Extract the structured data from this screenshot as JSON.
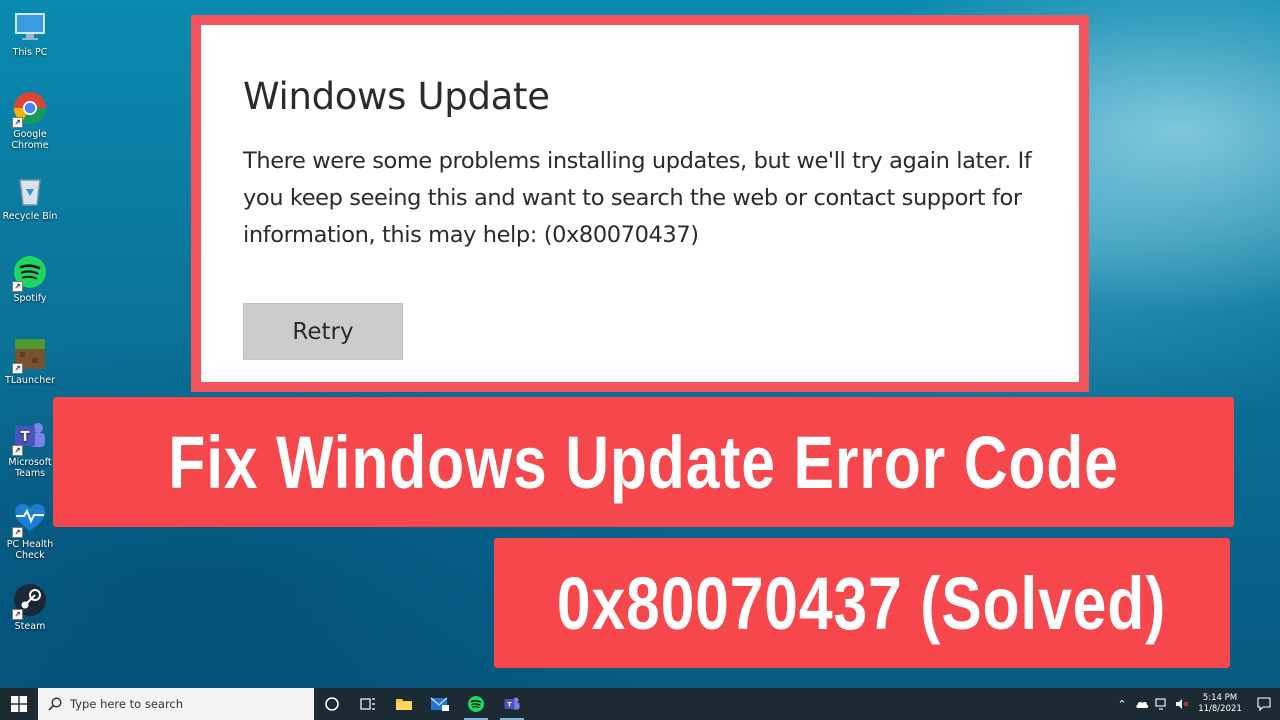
{
  "desktop_icons": [
    {
      "label": "This PC",
      "icon": "this-pc-icon"
    },
    {
      "label": "Google Chrome",
      "icon": "chrome-icon"
    },
    {
      "label": "Recycle Bin",
      "icon": "recycle-bin-icon"
    },
    {
      "label": "Spotify",
      "icon": "spotify-icon"
    },
    {
      "label": "TLauncher",
      "icon": "tlauncher-icon"
    },
    {
      "label": "Microsoft Teams",
      "icon": "teams-icon"
    },
    {
      "label": "PC Health Check",
      "icon": "pc-health-check-icon"
    },
    {
      "label": "Steam",
      "icon": "steam-icon"
    }
  ],
  "dialog": {
    "title": "Windows Update",
    "message": "There were some problems installing updates, but we'll try again later. If you keep seeing this and want to search the web or contact support for information, this may help: (0x80070437)",
    "retry_label": "Retry"
  },
  "banners": {
    "line1": "Fix Windows Update Error Code",
    "line2": "0x80070437 (Solved)"
  },
  "taskbar": {
    "search_placeholder": "Type here to search",
    "pinned": [
      "cortana-icon",
      "task-view-icon",
      "file-explorer-icon",
      "mail-icon",
      "spotify-icon",
      "teams-icon"
    ],
    "clock_time": "5:14 PM",
    "clock_date": "11/8/2021"
  },
  "colors": {
    "accent_red": "#f5474c",
    "dialog_border": "#f2555b",
    "taskbar": "#1c2a33"
  }
}
